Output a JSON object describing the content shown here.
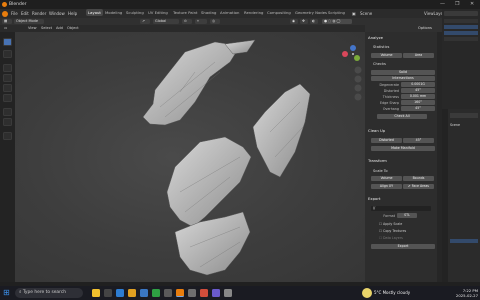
{
  "window": {
    "title": "Blender",
    "controls": [
      "—",
      "❐",
      "✕"
    ]
  },
  "menubar": {
    "items": [
      "File",
      "Edit",
      "Render",
      "Window",
      "Help"
    ],
    "workspaces": [
      "Layout",
      "Modeling",
      "Sculpting",
      "UV Editing",
      "Texture Paint",
      "Shading",
      "Animation",
      "Rendering",
      "Compositing",
      "Geometry Nodes",
      "Scripting"
    ],
    "active_workspace": "Layout",
    "scene": "Scene",
    "view_layer": "ViewLayer"
  },
  "header": {
    "mode": "Object Mode",
    "view": "View",
    "select": "Select",
    "add": "Add",
    "object": "Object",
    "orientation": "Global",
    "options": "Options"
  },
  "npanel": {
    "analyze": "Analyze",
    "statistics": "Statistics",
    "volume": "Volume",
    "area": "Area",
    "checks": "Checks",
    "solid": "Solid",
    "intersections": "Intersections",
    "degenerate_lbl": "Degenerate",
    "degenerate_val": "0.0001G",
    "distorted_lbl": "Distorted",
    "distorted_val": "45°",
    "thickness_lbl": "Thickness",
    "thickness_val": "0.001 mm",
    "edge_sharp_lbl": "Edge Sharp",
    "edge_sharp_val": "160°",
    "overhang_lbl": "Overhang",
    "overhang_val": "45°",
    "check_all": "Check All",
    "cleanup": "Clean Up",
    "distorted": "Distorted",
    "distorted2": "45°",
    "make_manifold": "Make Manifold",
    "transform": "Transform",
    "scale_to": "Scale To",
    "align_xy": "Align XY",
    "face_areas": "Face Areas",
    "export": "Export",
    "export_path": "//",
    "format_lbl": "Format",
    "format_val": "STL",
    "apply_scale": "Apply Scale",
    "copy_textures": "Copy Textures",
    "data_layers": "Data Layers",
    "export_btn": "Export"
  },
  "taskbar": {
    "search": "Type here to search",
    "weather": "5°C  Mostly cloudy",
    "time": "7:22 PM",
    "date": "2025-02-27"
  },
  "colors": {
    "accent": "#4772b3",
    "blender": "#e87d0d"
  }
}
